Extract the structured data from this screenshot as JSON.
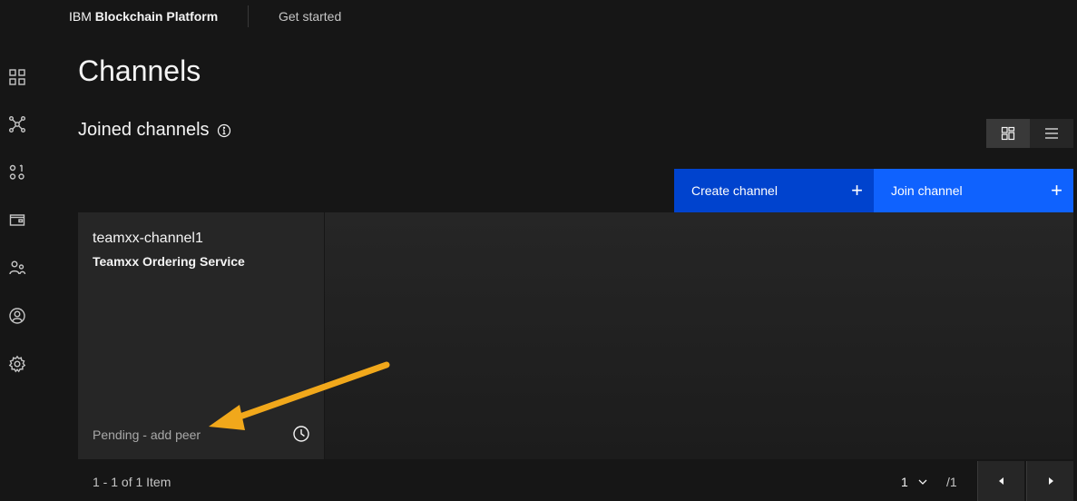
{
  "header": {
    "brand_prefix": "IBM",
    "brand_name": "Blockchain Platform",
    "get_started": "Get started"
  },
  "sidenav": {
    "items": [
      "dashboard-icon",
      "nodes-icon",
      "organizations-icon",
      "wallet-icon",
      "users-icon",
      "user-profile-icon",
      "settings-icon"
    ]
  },
  "page": {
    "title": "Channels",
    "section_title": "Joined channels"
  },
  "actions": {
    "create_channel": "Create channel",
    "join_channel": "Join channel",
    "plus": "+"
  },
  "tiles": [
    {
      "name": "teamxx-channel1",
      "subtitle": "Teamxx Ordering Service",
      "status": "Pending - add peer"
    }
  ],
  "pagination": {
    "items_text": "1 - 1 of 1 Item",
    "current_page": "1",
    "total_pages": "/1"
  },
  "colors": {
    "background": "#161616",
    "tile": "#262626",
    "primary": "#0f62fe",
    "primary_dark": "#0043ce",
    "annotation_arrow": "#f1a81b"
  }
}
